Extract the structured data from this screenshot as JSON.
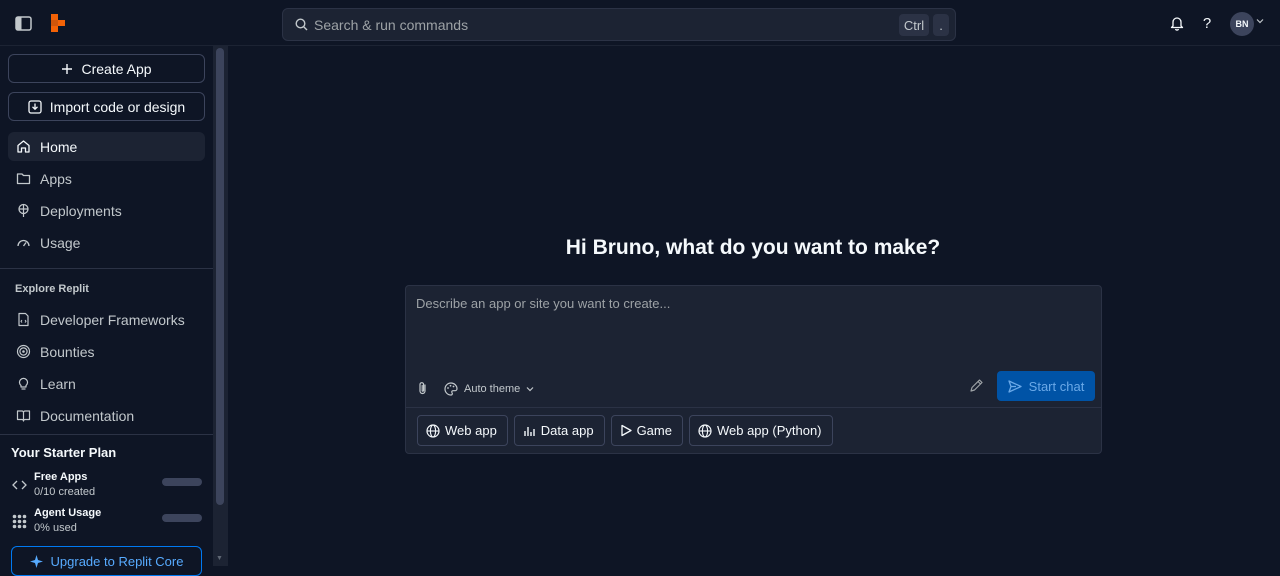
{
  "topbar": {
    "search_placeholder": "Search & run commands",
    "shortcut_ctrl": "Ctrl",
    "shortcut_key": ".",
    "help_label": "?",
    "avatar_initials": "BN"
  },
  "sidebar": {
    "create_app": "Create App",
    "import": "Import code or design",
    "nav": [
      {
        "label": "Home",
        "icon": "home-icon",
        "active": true
      },
      {
        "label": "Apps",
        "icon": "folder-icon"
      },
      {
        "label": "Deployments",
        "icon": "deployments-icon"
      },
      {
        "label": "Usage",
        "icon": "gauge-icon"
      }
    ],
    "explore_title": "Explore Replit",
    "explore": [
      {
        "label": "Developer Frameworks",
        "icon": "frameworks-icon"
      },
      {
        "label": "Bounties",
        "icon": "bounties-icon"
      },
      {
        "label": "Learn",
        "icon": "lightbulb-icon"
      },
      {
        "label": "Documentation",
        "icon": "book-icon"
      }
    ],
    "plan": {
      "title": "Your Starter Plan",
      "free_apps_title": "Free Apps",
      "free_apps_sub": "0/10 created",
      "free_apps_progress": 0,
      "agent_title": "Agent Usage",
      "agent_sub": "0% used",
      "agent_progress": 0
    },
    "upgrade": "Upgrade to Replit Core"
  },
  "main": {
    "greeting": "Hi Bruno, what do you want to make?",
    "prompt_placeholder": "Describe an app or site you want to create...",
    "theme_label": "Auto theme",
    "start_chat": "Start chat",
    "chips": [
      "Web app",
      "Data app",
      "Game",
      "Web app (Python)"
    ]
  },
  "colors": {
    "background": "#0e1525",
    "surface": "#1c2333",
    "border": "#3c445c",
    "accent": "#0079f2",
    "logo": "#f26207"
  }
}
